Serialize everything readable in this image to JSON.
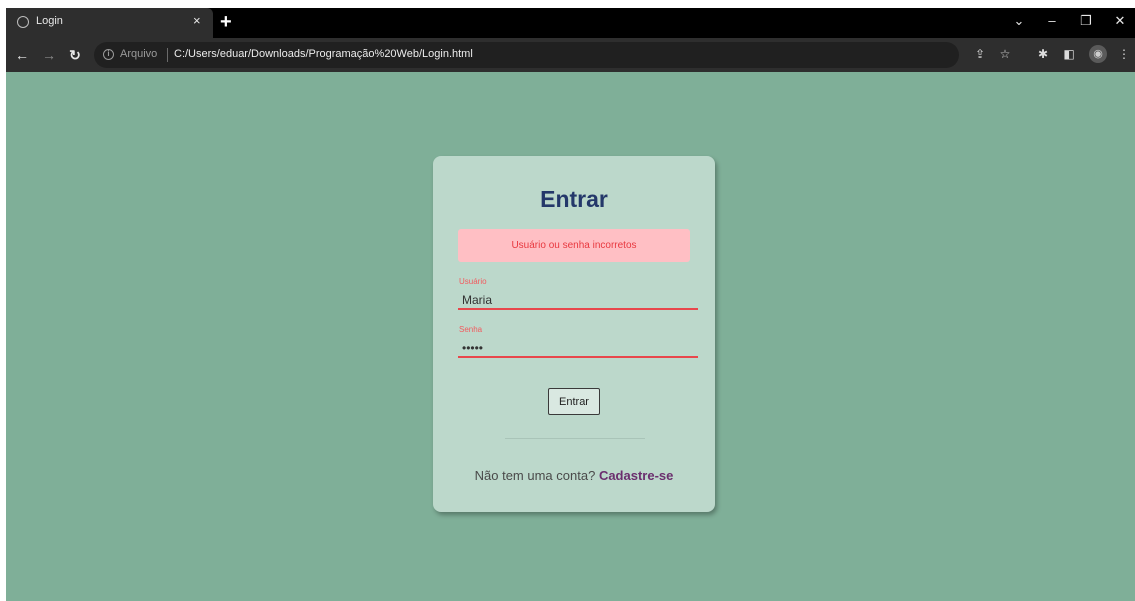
{
  "browser": {
    "tab_title": "Login",
    "tab_close": "×",
    "new_tab": "+",
    "security_label": "Arquivo",
    "url": "C:/Users/eduar/Downloads/Programação%20Web/Login.html",
    "window_controls": {
      "dropdown": "⌄",
      "minimize": "–",
      "restore": "❐",
      "close": "✕"
    },
    "nav": {
      "back": "←",
      "forward": "→",
      "reload": "↻"
    },
    "icons": [
      "share-icon",
      "star-icon",
      "extensions-icon",
      "sidepanel-icon",
      "profile-icon",
      "menu-icon"
    ]
  },
  "page": {
    "background_color": "#7faf98",
    "login": {
      "title": "Entrar",
      "error_message": "Usuário ou senha incorretos",
      "username_label": "Usuário",
      "username_value": "Maria",
      "password_label": "Senha",
      "password_value": "•••••",
      "submit_label": "Entrar",
      "signup_prompt": "Não tem uma conta?",
      "signup_link": "Cadastre-se"
    },
    "colors": {
      "card": "#bcd8cb",
      "title": "#24386a",
      "error_bg": "#ffbfc4",
      "error_text": "#e8383f",
      "link": "#6b2f6e"
    }
  }
}
